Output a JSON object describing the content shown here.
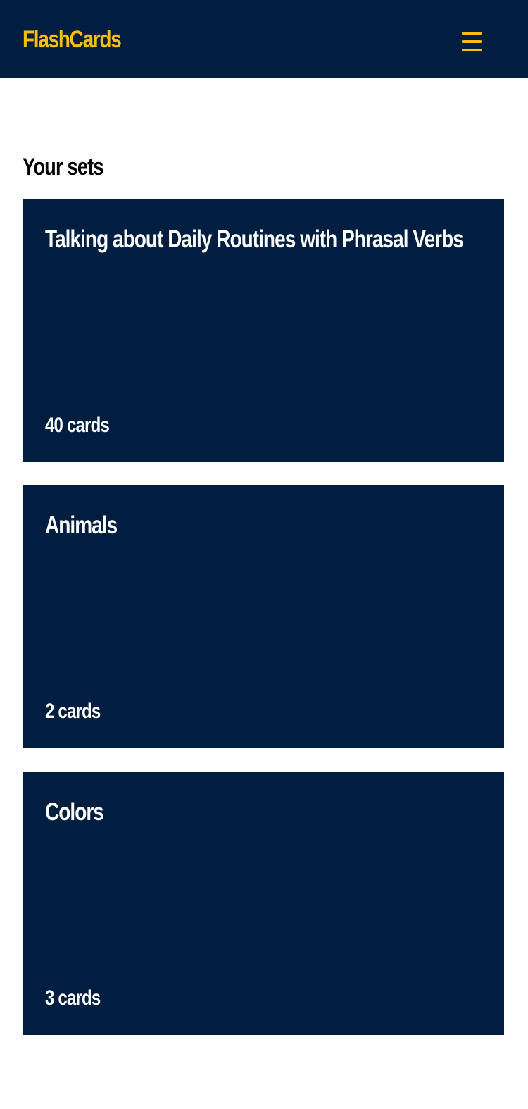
{
  "colors": {
    "navy": "#001e3f",
    "accent": "#fbbf08",
    "text_light": "#ffffff",
    "background": "#ffffff"
  },
  "header": {
    "brand": "FlashCards",
    "menu_icon": "hamburger-menu-icon"
  },
  "main": {
    "section_title": "Your sets",
    "sets": [
      {
        "title": "Talking about Daily Routines with Phrasal Verbs",
        "count": "40 cards"
      },
      {
        "title": "Animals",
        "count": "2 cards"
      },
      {
        "title": "Colors",
        "count": "3 cards"
      }
    ]
  }
}
